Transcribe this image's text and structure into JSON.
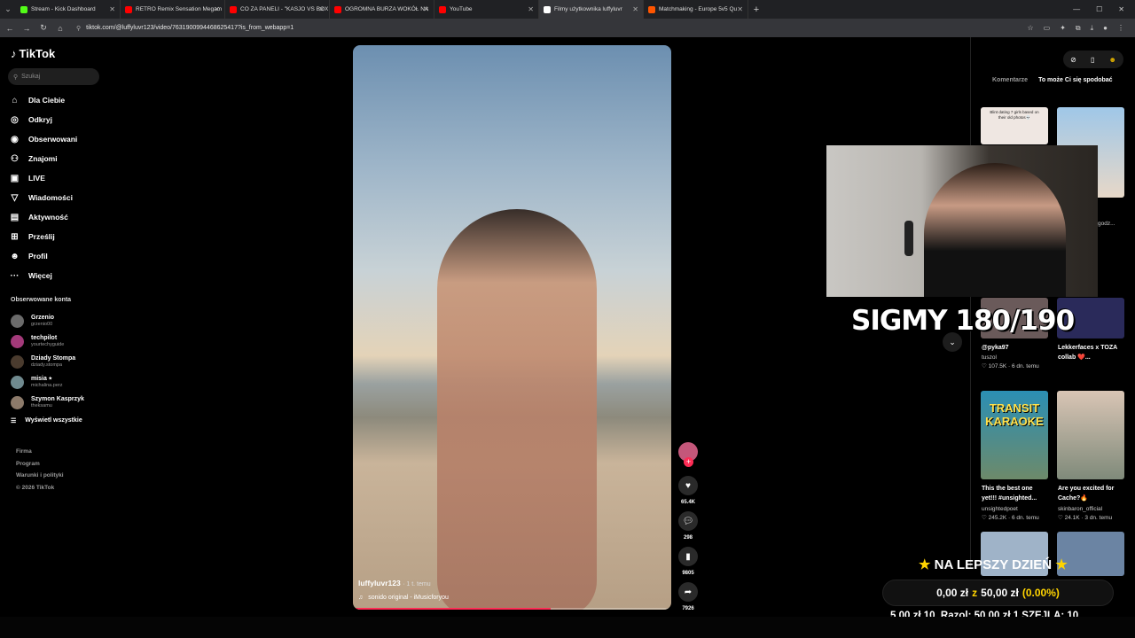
{
  "browser": {
    "tabs": [
      {
        "label": "Stream - Kick Dashboard",
        "color": "#53fc18"
      },
      {
        "label": "RETRO Remix Sensation Megam",
        "color": "#ff0000"
      },
      {
        "label": "CO ZA PANELI - \"KASJO VS BOX",
        "color": "#ff0000"
      },
      {
        "label": "OGROMNA BURZA WOKÓŁ NA",
        "color": "#ff0000"
      },
      {
        "label": "YouTube",
        "color": "#ff0000"
      },
      {
        "label": "Filmy użytkownika luffyluvr",
        "color": "#ffffff",
        "active": true
      },
      {
        "label": "Matchmaking - Europe 5v5 Qu",
        "color": "#ff5500"
      }
    ],
    "url": "tiktok.com/@luffyluvr123/video/7631900994468625417?is_from_webapp=1"
  },
  "sidebar": {
    "logo": "TikTok",
    "search_placeholder": "Szukaj",
    "menu": [
      {
        "label": "Dla Ciebie",
        "icon": "home-icon",
        "glyph": "⌂"
      },
      {
        "label": "Odkryj",
        "icon": "compass-icon",
        "glyph": "◎"
      },
      {
        "label": "Obserwowani",
        "icon": "following-icon",
        "glyph": "◉"
      },
      {
        "label": "Znajomi",
        "icon": "friends-icon",
        "glyph": "⚇"
      },
      {
        "label": "LIVE",
        "icon": "live-icon",
        "glyph": "▣"
      },
      {
        "label": "Wiadomości",
        "icon": "messages-icon",
        "glyph": "▽"
      },
      {
        "label": "Aktywność",
        "icon": "activity-icon",
        "glyph": "▤"
      },
      {
        "label": "Prześlij",
        "icon": "upload-icon",
        "glyph": "⊞"
      },
      {
        "label": "Profil",
        "icon": "profile-icon",
        "glyph": "☻"
      },
      {
        "label": "Więcej",
        "icon": "more-icon",
        "glyph": "···"
      }
    ],
    "following_title": "Obserwowane konta",
    "following": [
      {
        "name": "Grzenio",
        "handle": "grzenio00",
        "color": "#6b6b6b"
      },
      {
        "name": "techpilot",
        "handle": "yourtechyguide",
        "color": "#a33a7a"
      },
      {
        "name": "Dziady Stompa",
        "handle": "dziady.stompa",
        "color": "#4a3b2e"
      },
      {
        "name": "misia ⭑",
        "handle": "michalina.perz",
        "color": "#708a8f"
      },
      {
        "name": "Szymon Kasprzyk",
        "handle": "theksamu",
        "color": "#8c7a6a"
      }
    ],
    "show_all": "Wyświetl wszystkie",
    "footer": [
      "Firma",
      "Program",
      "Warunki i polityki",
      "© 2026 TikTok"
    ]
  },
  "video": {
    "username": "luffyluvr123",
    "age": "· 1 t. temu",
    "sound": "sonido original - iMusicforyou",
    "progress": 0.62,
    "likes": "65.4K",
    "comments": "298",
    "saves": "9805",
    "shares": "7926"
  },
  "right_panel": {
    "tab_comments": "Komentarze",
    "tab_suggested": "To może Ci się spodobać",
    "cards": [
      {
        "title": "@pyka97",
        "author": "tuszol",
        "stats": "♡ 107.5K · 6 dn. temu",
        "color": "#6a5a5a"
      },
      {
        "title": "Lekkerfaces x TOZA collab ❤️...",
        "author": "",
        "stats": "",
        "color": "#2a2a5a"
      },
      {
        "title": "This the best one yet!!! #unsighted...",
        "author": "unsightedpoet",
        "stats": "♡ 245.2K · 6 dn. temu",
        "color": "#5a7d6a",
        "thumb_text": "TRANSIT KARAOKE"
      },
      {
        "title": "Are you excited for Cache?🔥",
        "author": "skinbaron_official",
        "stats": "♡ 24.1K · 3 dn. temu",
        "color": "#a08a70"
      }
    ],
    "partial_author": "godz...",
    "top_thumb_caption": "Blint dating 7 girls based on their old photos💀"
  },
  "overlay": {
    "sigmy": "SIGMY 180/190",
    "goal_title": "NA LEPSZY DZIEŃ",
    "goal_amount": "0,00 zł",
    "goal_of": "z",
    "goal_target": "50,00 zł",
    "goal_percent": "(0.00%)",
    "ticker": "5,00 zł  10. Razol: 50,00 zł  1.SZEJLA: 10"
  }
}
